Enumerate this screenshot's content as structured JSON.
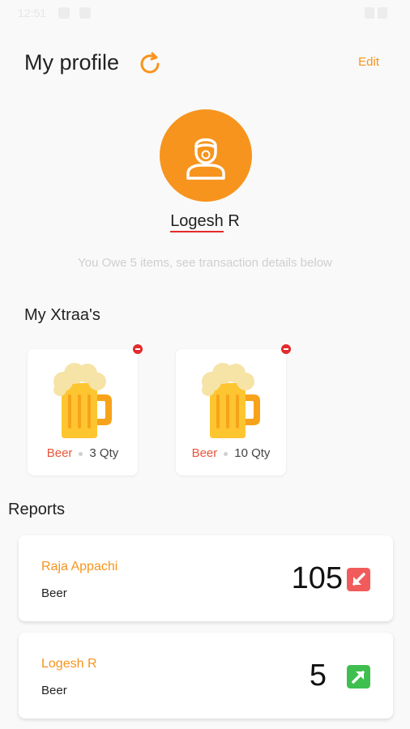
{
  "status_bar": {
    "time": "12:51"
  },
  "header": {
    "title": "My profile",
    "edit_label": "Edit"
  },
  "profile": {
    "name_underlined": "Logesh",
    "name_rest": " R",
    "owe_text": "You Owe 5 items, see transaction details below"
  },
  "xtraas": {
    "title": "My Xtraa's",
    "items": [
      {
        "name": "Beer",
        "qty": "3 Qty"
      },
      {
        "name": "Beer",
        "qty": "10 Qty"
      }
    ]
  },
  "reports": {
    "title": "Reports",
    "items": [
      {
        "name": "Raja Appachi",
        "item": "Beer",
        "value": "105",
        "direction": "incoming"
      },
      {
        "name": "Logesh R",
        "item": "Beer",
        "value": "5",
        "direction": "outgoing"
      }
    ]
  },
  "colors": {
    "accent": "#f7941d",
    "incoming_arrow": "#f25b5b",
    "outgoing_arrow": "#3fbf4f",
    "item_name": "#e8553a"
  },
  "icons": {
    "refresh": "refresh-icon",
    "avatar": "user-icon",
    "beer": "beer-mug-icon",
    "remove": "remove-icon",
    "incoming": "arrow-down-left-icon",
    "outgoing": "arrow-up-right-icon"
  }
}
